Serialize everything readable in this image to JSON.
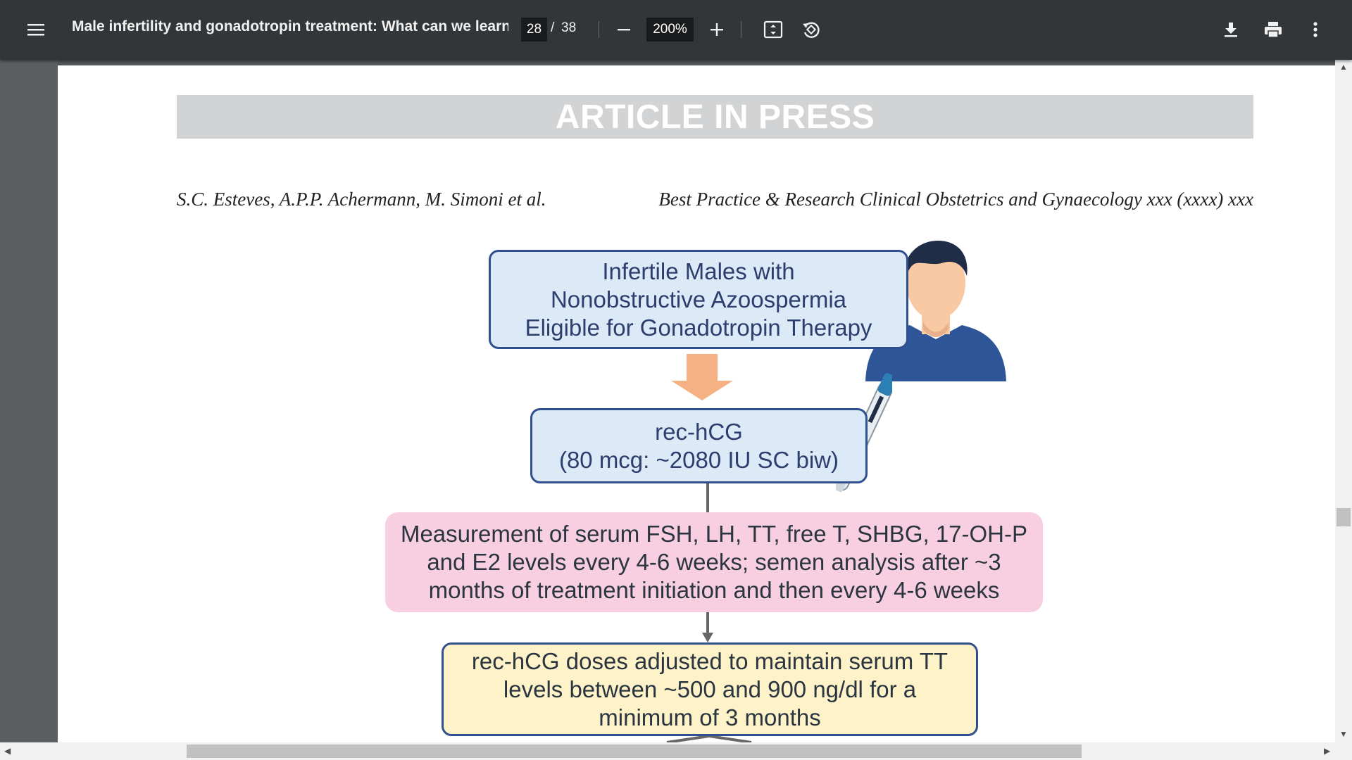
{
  "toolbar": {
    "menu_icon": "hamburger-menu-icon",
    "title": "Male infertility and gonadotropin treatment: What can we learn ...",
    "current_page": "28",
    "page_separator": "/",
    "total_pages": "38",
    "zoom_out_icon": "minus-icon",
    "zoom_value": "200%",
    "zoom_in_icon": "plus-icon",
    "fit_icon": "fit-to-page-icon",
    "rotate_icon": "rotate-counterclockwise-icon",
    "download_icon": "download-icon",
    "print_icon": "print-icon",
    "more_icon": "more-vertical-icon"
  },
  "document": {
    "banner": "ARTICLE IN PRESS",
    "authors": "S.C. Esteves, A.P.P. Achermann, M. Simoni et al.",
    "journal": "Best Practice & Research Clinical Obstetrics and Gynaecology xxx (xxxx) xxx",
    "flowchart": {
      "box1": "Infertile Males with\nNonobstructive Azoospermia\nEligible for Gonadotropin Therapy",
      "box2": "rec-hCG\n(80 mcg: ~2080 IU SC biw)",
      "box3": "Measurement of serum FSH, LH, TT, free T, SHBG, 17-OH-P\nand E2 levels every 4-6 weeks; semen analysis after ~3\nmonths of treatment initiation and then every 4-6 weeks",
      "box4": "rec-hCG doses adjusted to maintain serum TT\nlevels between ~500 and 900 ng/dl for a\nminimum of 3 months",
      "person_icon": "male-patient-icon",
      "pen_icon": "injection-pen-icon",
      "arrow_icon": "down-arrow-icon"
    }
  },
  "colors": {
    "toolbar_bg": "#323639",
    "box_blue": "#dce9f6",
    "box_pink": "#f8cfe0",
    "box_yellow": "#fdf2c8",
    "border_navy": "#2f4f8e",
    "arrow_orange": "#f5b183"
  }
}
